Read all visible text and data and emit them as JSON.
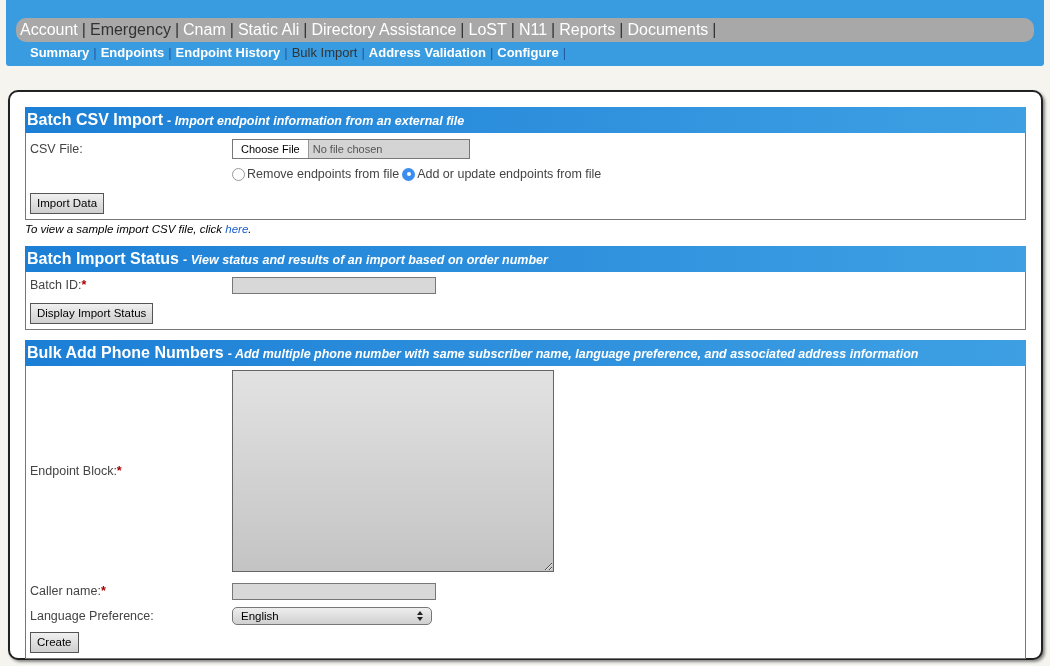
{
  "main_nav": [
    {
      "label": "Account",
      "separator": "|",
      "selected": false
    },
    {
      "label": "Emergency",
      "separator": "|",
      "selected": true
    },
    {
      "label": "Cnam",
      "separator": "|",
      "selected": false
    },
    {
      "label": "Static Ali",
      "separator": "|",
      "selected": false
    },
    {
      "label": "Directory Assistance",
      "separator": "|",
      "selected": false
    },
    {
      "label": "LoST",
      "separator": "|",
      "selected": false
    },
    {
      "label": "N11",
      "separator": "|",
      "selected": false
    },
    {
      "label": "Reports",
      "separator": "|",
      "selected": false
    },
    {
      "label": "Documents",
      "separator": "|",
      "selected": false
    }
  ],
  "sub_nav": [
    {
      "label": "Summary",
      "separator": "|",
      "selected": false
    },
    {
      "label": "Endpoints",
      "separator": "|",
      "selected": false
    },
    {
      "label": "Endpoint History",
      "separator": "|",
      "selected": false
    },
    {
      "label": "Bulk Import",
      "separator": "|",
      "selected": true
    },
    {
      "label": "Address Validation",
      "separator": "|",
      "selected": false
    },
    {
      "label": "Configure",
      "separator": "|",
      "selected": false
    }
  ],
  "csv_import": {
    "title": "Batch CSV Import",
    "subtitle": "- Import endpoint information from an external file",
    "file_label": "CSV File:",
    "choose_button": "Choose File",
    "file_status": "No file chosen",
    "options": [
      {
        "label": "Remove endpoints from file",
        "selected": false
      },
      {
        "label": "Add or update endpoints from file",
        "selected": true
      }
    ],
    "button": "Import Data",
    "note": "To view a sample import CSV file, click",
    "link": "here",
    "note_end": "."
  },
  "import_status": {
    "title": "Batch Import Status",
    "subtitle": "- View status and results of an import based on order number",
    "field_label": "Batch ID:",
    "required_mark": "*",
    "button": "Display Import Status"
  },
  "bulk_add": {
    "title": "Bulk Add Phone Numbers",
    "subtitle": "- Add multiple phone number with same subscriber name, language preference, and associated address information",
    "block_label": "Endpoint Block:",
    "block_required": "*",
    "caller_label": "Caller name:",
    "caller_required": "*",
    "language_label": "Language Preference:",
    "language_value": "English",
    "button": "Create"
  }
}
